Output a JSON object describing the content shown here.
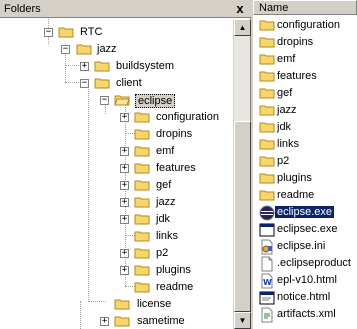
{
  "folders_pane": {
    "title": "Folders",
    "close_label": "x",
    "tree": [
      {
        "label": "RTC",
        "expander": "−"
      },
      {
        "label": "jazz",
        "expander": "−"
      },
      {
        "label": "buildsystem",
        "expander": "+"
      },
      {
        "label": "client",
        "expander": "−"
      },
      {
        "label": "eclipse",
        "expander": "−",
        "selected": true
      },
      {
        "label": "configuration",
        "expander": "+"
      },
      {
        "label": "dropins",
        "expander": ""
      },
      {
        "label": "emf",
        "expander": "+"
      },
      {
        "label": "features",
        "expander": "+"
      },
      {
        "label": "gef",
        "expander": "+"
      },
      {
        "label": "jazz",
        "expander": "+"
      },
      {
        "label": "jdk",
        "expander": "+"
      },
      {
        "label": "links",
        "expander": ""
      },
      {
        "label": "p2",
        "expander": "+"
      },
      {
        "label": "plugins",
        "expander": "+"
      },
      {
        "label": "readme",
        "expander": ""
      },
      {
        "label": "license",
        "expander": ""
      },
      {
        "label": "sametime",
        "expander": "+"
      }
    ]
  },
  "files_pane": {
    "column_header": "Name",
    "items": [
      {
        "label": "configuration",
        "icon": "folder-icon"
      },
      {
        "label": "dropins",
        "icon": "folder-icon"
      },
      {
        "label": "emf",
        "icon": "folder-icon"
      },
      {
        "label": "features",
        "icon": "folder-icon"
      },
      {
        "label": "gef",
        "icon": "folder-icon"
      },
      {
        "label": "jazz",
        "icon": "folder-icon"
      },
      {
        "label": "jdk",
        "icon": "folder-icon"
      },
      {
        "label": "links",
        "icon": "folder-icon"
      },
      {
        "label": "p2",
        "icon": "folder-icon"
      },
      {
        "label": "plugins",
        "icon": "folder-icon"
      },
      {
        "label": "readme",
        "icon": "folder-icon"
      },
      {
        "label": "eclipse.exe",
        "icon": "eclipse-icon",
        "selected": true
      },
      {
        "label": "eclipsec.exe",
        "icon": "console-exe-icon"
      },
      {
        "label": "eclipse.ini",
        "icon": "ini-file-icon"
      },
      {
        "label": ".eclipseproduct",
        "icon": "generic-file-icon"
      },
      {
        "label": "epl-v10.html",
        "icon": "html-file-icon"
      },
      {
        "label": "notice.html",
        "icon": "html-file-icon"
      },
      {
        "label": "artifacts.xml",
        "icon": "xml-file-icon"
      }
    ]
  },
  "colors": {
    "folder_fill": "#f7d66b",
    "folder_edge": "#b08a20",
    "selection": "#0a246a"
  }
}
